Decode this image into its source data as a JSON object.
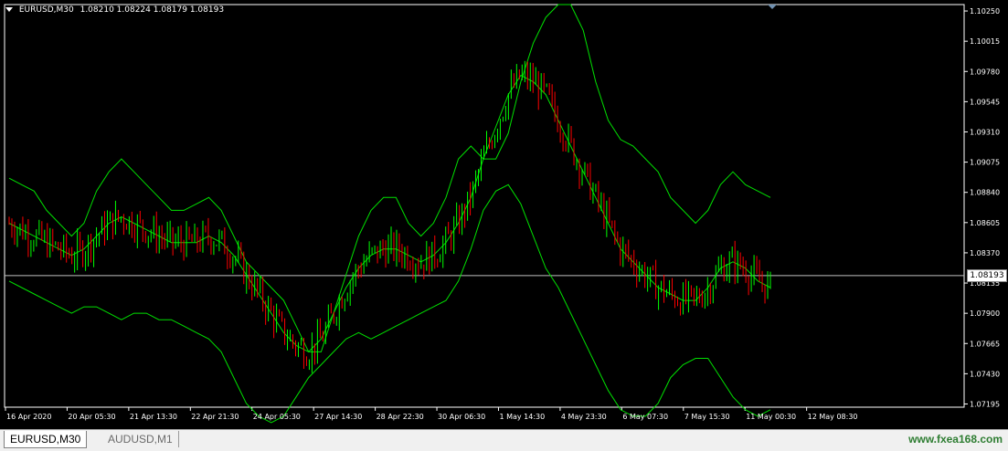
{
  "header": {
    "symbol": "EURUSD,M30",
    "ohlc": "1.08210 1.08224 1.08179 1.08193"
  },
  "current_price_label": "1.08193",
  "tabs": [
    {
      "label": "EURUSD,M30",
      "active": true
    },
    {
      "label": "AUDUSD,M1",
      "active": false
    }
  ],
  "watermark": "www.fxea168.com",
  "colors": {
    "background": "#000000",
    "bollinger": "#00e000",
    "bull_candle": "#00ff00",
    "bear_candle": "#ff0000",
    "price_line": "#c0c0c0",
    "axis_text": "#ffffff"
  },
  "chart_data": {
    "type": "line",
    "title": "EURUSD,M30",
    "price_axis_ticks": [
      1.1025,
      1.10015,
      1.0978,
      1.09545,
      1.0931,
      1.09075,
      1.0884,
      1.08605,
      1.0837,
      1.08135,
      1.079,
      1.07665,
      1.0743,
      1.07195
    ],
    "time_labels": [
      "16 Apr 2020",
      "20 Apr 05:30",
      "21 Apr 13:30",
      "22 Apr 21:30",
      "24 Apr 05:30",
      "27 Apr 14:30",
      "28 Apr 22:30",
      "30 Apr 06:30",
      "1 May 14:30",
      "4 May 23:30",
      "6 May 07:30",
      "7 May 15:30",
      "11 May 00:30",
      "12 May 08:30"
    ],
    "ylim": [
      1.0717,
      1.103
    ],
    "current_price": 1.08193,
    "grid": false,
    "series": [
      {
        "values": [
          1.0895,
          1.089,
          1.0885,
          1.087,
          1.086,
          1.085,
          1.086,
          1.0885,
          1.09,
          1.091,
          1.09,
          1.089,
          1.088,
          1.087,
          1.087,
          1.0875,
          1.088,
          1.087,
          1.085,
          1.083,
          1.082,
          1.081,
          1.08,
          1.078,
          1.076,
          1.076,
          1.079,
          1.082,
          1.085,
          1.087,
          1.088,
          1.088,
          1.086,
          1.085,
          1.086,
          1.088,
          1.091,
          1.092,
          1.091,
          1.091,
          1.093,
          1.097,
          1.1,
          1.102,
          1.103,
          1.103,
          1.101,
          1.097,
          1.094,
          1.0925,
          1.092,
          1.091,
          1.09,
          1.088,
          1.087,
          1.086,
          1.087,
          1.089,
          1.09,
          1.089,
          1.0885,
          1.088
        ]
      },
      {
        "values": [
          1.086,
          1.0855,
          1.085,
          1.0845,
          1.084,
          1.0835,
          1.084,
          1.085,
          1.086,
          1.0865,
          1.086,
          1.0855,
          1.085,
          1.0845,
          1.0845,
          1.0845,
          1.085,
          1.0845,
          1.0835,
          1.082,
          1.0805,
          1.079,
          1.0775,
          1.0765,
          1.076,
          1.077,
          1.079,
          1.081,
          1.0825,
          1.0835,
          1.084,
          1.084,
          1.0835,
          1.083,
          1.0835,
          1.0845,
          1.086,
          1.088,
          1.091,
          1.0935,
          1.096,
          1.0975,
          1.097,
          1.096,
          1.094,
          1.092,
          1.09,
          1.088,
          1.086,
          1.084,
          1.083,
          1.082,
          1.081,
          1.0805,
          1.08,
          1.08,
          1.081,
          1.0825,
          1.083,
          1.0825,
          1.0815,
          1.081
        ]
      },
      {
        "values": [
          1.0815,
          1.081,
          1.0805,
          1.08,
          1.0795,
          1.079,
          1.0795,
          1.0795,
          1.079,
          1.0785,
          1.079,
          1.079,
          1.0785,
          1.0785,
          1.078,
          1.0775,
          1.077,
          1.076,
          1.074,
          1.072,
          1.071,
          1.0705,
          1.071,
          1.0725,
          1.074,
          1.075,
          1.076,
          1.077,
          1.0775,
          1.077,
          1.0775,
          1.078,
          1.0785,
          1.079,
          1.0795,
          1.08,
          1.0815,
          1.084,
          1.087,
          1.0885,
          1.089,
          1.0875,
          1.085,
          1.0825,
          1.081,
          1.079,
          1.077,
          1.075,
          1.073,
          1.0715,
          1.071,
          1.071,
          1.072,
          1.074,
          1.075,
          1.0755,
          1.0755,
          1.074,
          1.0725,
          1.0715,
          1.071,
          1.0715
        ]
      }
    ]
  }
}
